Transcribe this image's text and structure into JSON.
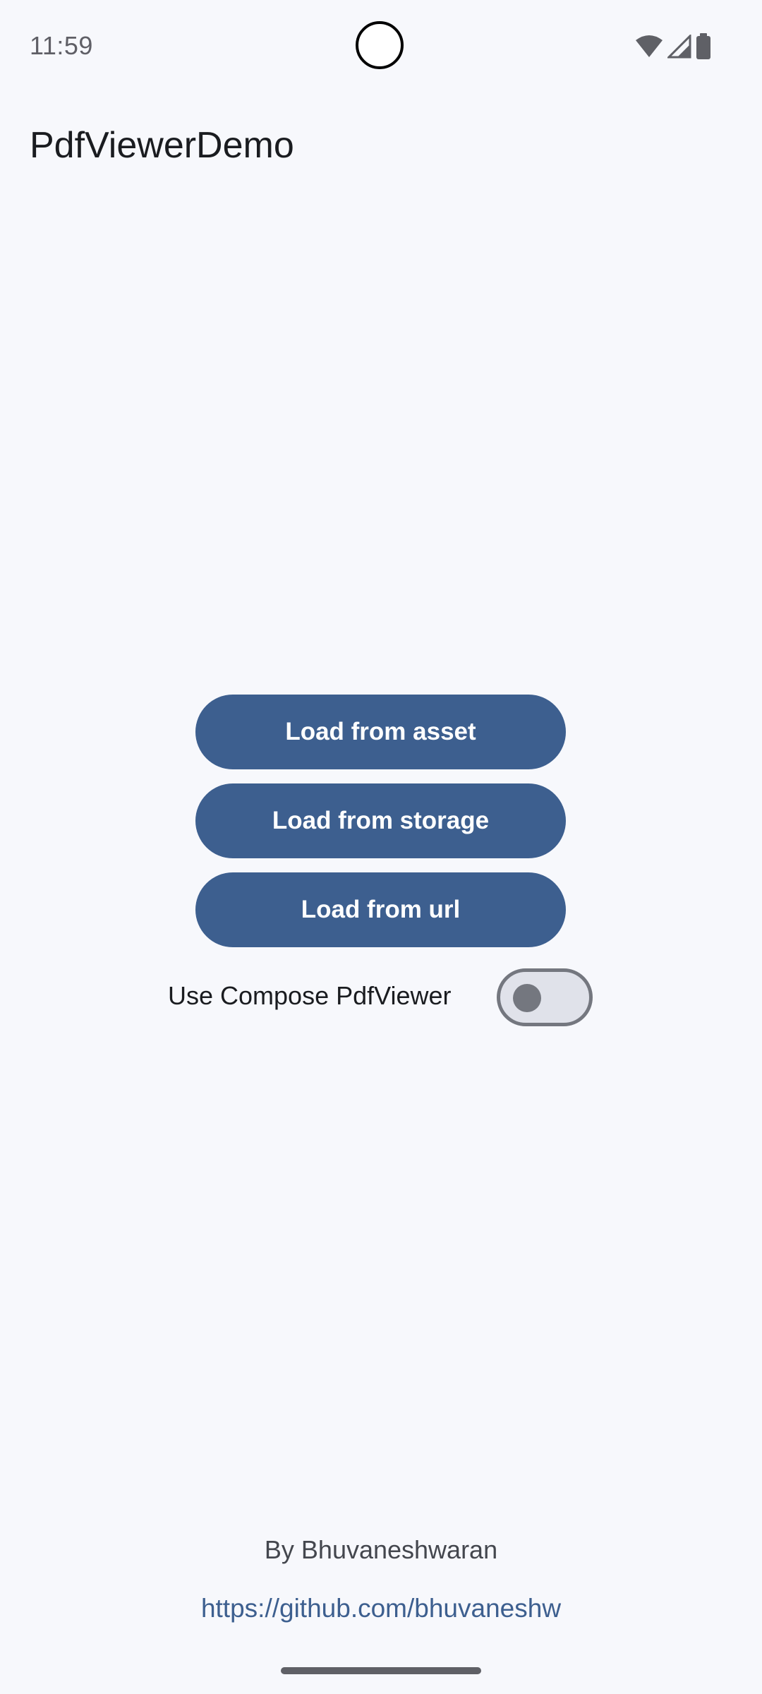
{
  "status_bar": {
    "time": "11:59",
    "icons": [
      "wifi-icon",
      "signal-icon",
      "battery-icon"
    ]
  },
  "app_bar": {
    "title": "PdfViewerDemo"
  },
  "actions": {
    "load_asset_label": "Load from asset",
    "load_storage_label": "Load from storage",
    "load_url_label": "Load from url"
  },
  "settings": {
    "compose_switch_label": "Use Compose PdfViewer",
    "compose_switch_on": false
  },
  "footer": {
    "author": "By Bhuvaneshwaran",
    "link": "https://github.com/bhuvaneshw"
  },
  "colors": {
    "background": "#f7f8fc",
    "primary": "#3d5f8f",
    "on_primary": "#ffffff",
    "text": "#1a1c20",
    "outline": "#74777f"
  }
}
